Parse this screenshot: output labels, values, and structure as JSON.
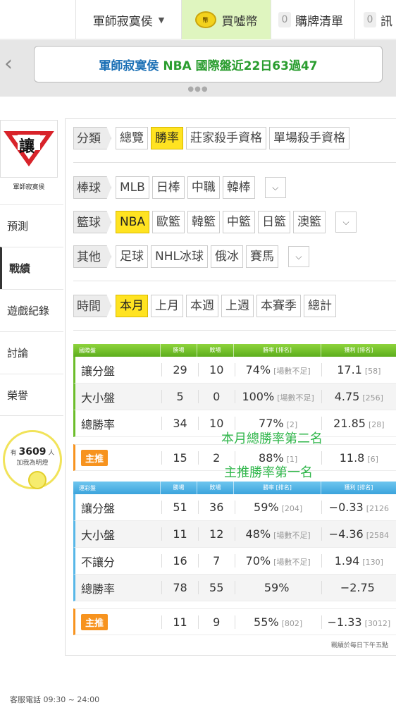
{
  "topbar": {
    "user_label": "軍師寂寞侯",
    "coin_icon_text": "幣",
    "coin_label": "買噓幣",
    "cart_count": "0",
    "cart_label": "購牌清單",
    "msg_count": "0",
    "msg_label": "訊"
  },
  "banner": {
    "name": "軍師寂寞侯",
    "text": "NBA 國際盤近22日63過47",
    "dots": "●●●",
    "name_color": "#1a6fb5",
    "text_color": "#2a9d2f"
  },
  "profile": {
    "logo_text": "讓",
    "name": "軍師寂寞侯"
  },
  "sidebar": {
    "items": [
      {
        "label": "預測"
      },
      {
        "label": "戰績"
      },
      {
        "label": "遊戲紀錄"
      },
      {
        "label": "討論"
      },
      {
        "label": "榮譽"
      }
    ],
    "fans_prefix": "有",
    "fans_count": "3609",
    "fans_suffix": "人",
    "fans_label": "加我為明燈"
  },
  "filters": {
    "category": {
      "label": "分類",
      "options": [
        "總覽",
        "勝率",
        "莊家殺手資格",
        "單場殺手資格"
      ],
      "selected": 1
    },
    "baseball": {
      "label": "棒球",
      "options": [
        "MLB",
        "日棒",
        "中職",
        "韓棒"
      ]
    },
    "basketball": {
      "label": "籃球",
      "options": [
        "NBA",
        "歐籃",
        "韓籃",
        "中籃",
        "日籃",
        "澳籃"
      ],
      "selected": 0
    },
    "other": {
      "label": "其他",
      "options": [
        "足球",
        "NHL冰球",
        "俄冰",
        "賽馬"
      ]
    },
    "time": {
      "label": "時間",
      "options": [
        "本月",
        "上月",
        "本週",
        "上週",
        "本賽季",
        "總計"
      ],
      "selected": 0
    },
    "more_icon": "chevron-down"
  },
  "table_intl": {
    "headers": [
      "國際盤",
      "勝場",
      "敗場",
      "勝率 [排名]",
      "獲利 [排名]"
    ],
    "rows": [
      {
        "name": "讓分盤",
        "win": "29",
        "lose": "10",
        "rate": "74%",
        "rate_rank": "[場數不足]",
        "profit": "17.1",
        "profit_rank": "[58]"
      },
      {
        "name": "大小盤",
        "win": "5",
        "lose": "0",
        "rate": "100%",
        "rate_rank": "[場數不足]",
        "profit": "4.75",
        "profit_rank": "[256]"
      },
      {
        "name": "總勝率",
        "win": "34",
        "lose": "10",
        "rate": "77%",
        "rate_rank": "[2]",
        "profit": "21.85",
        "profit_rank": "[28]"
      }
    ],
    "main": {
      "name": "主推",
      "win": "15",
      "lose": "2",
      "rate": "88%",
      "rate_rank": "[1]",
      "profit": "11.8",
      "profit_rank": "[6]"
    }
  },
  "table_lottery": {
    "headers": [
      "運彩盤",
      "勝場",
      "敗場",
      "勝率 [排名]",
      "獲利 [排名]"
    ],
    "rows": [
      {
        "name": "讓分盤",
        "win": "51",
        "lose": "36",
        "rate": "59%",
        "rate_rank": "[204]",
        "profit": "−0.33",
        "profit_rank": "[2126"
      },
      {
        "name": "大小盤",
        "win": "11",
        "lose": "12",
        "rate": "48%",
        "rate_rank": "[場數不足]",
        "profit": "−4.36",
        "profit_rank": "[2584"
      },
      {
        "name": "不讓分",
        "win": "16",
        "lose": "7",
        "rate": "70%",
        "rate_rank": "[場數不足]",
        "profit": "1.94",
        "profit_rank": "[130]"
      },
      {
        "name": "總勝率",
        "win": "78",
        "lose": "55",
        "rate": "59%",
        "rate_rank": "",
        "profit": "−2.75",
        "profit_rank": ""
      }
    ],
    "main": {
      "name": "主推",
      "win": "11",
      "lose": "9",
      "rate": "55%",
      "rate_rank": "[802]",
      "profit": "−1.33",
      "profit_rank": "[3012]"
    }
  },
  "overlays": {
    "month_rank": "本月總勝率第二名",
    "main_rank": "主推勝率第一名"
  },
  "note": "戰績於每日下午五點",
  "footer": "客服電話 09:30 ~ 24:00"
}
